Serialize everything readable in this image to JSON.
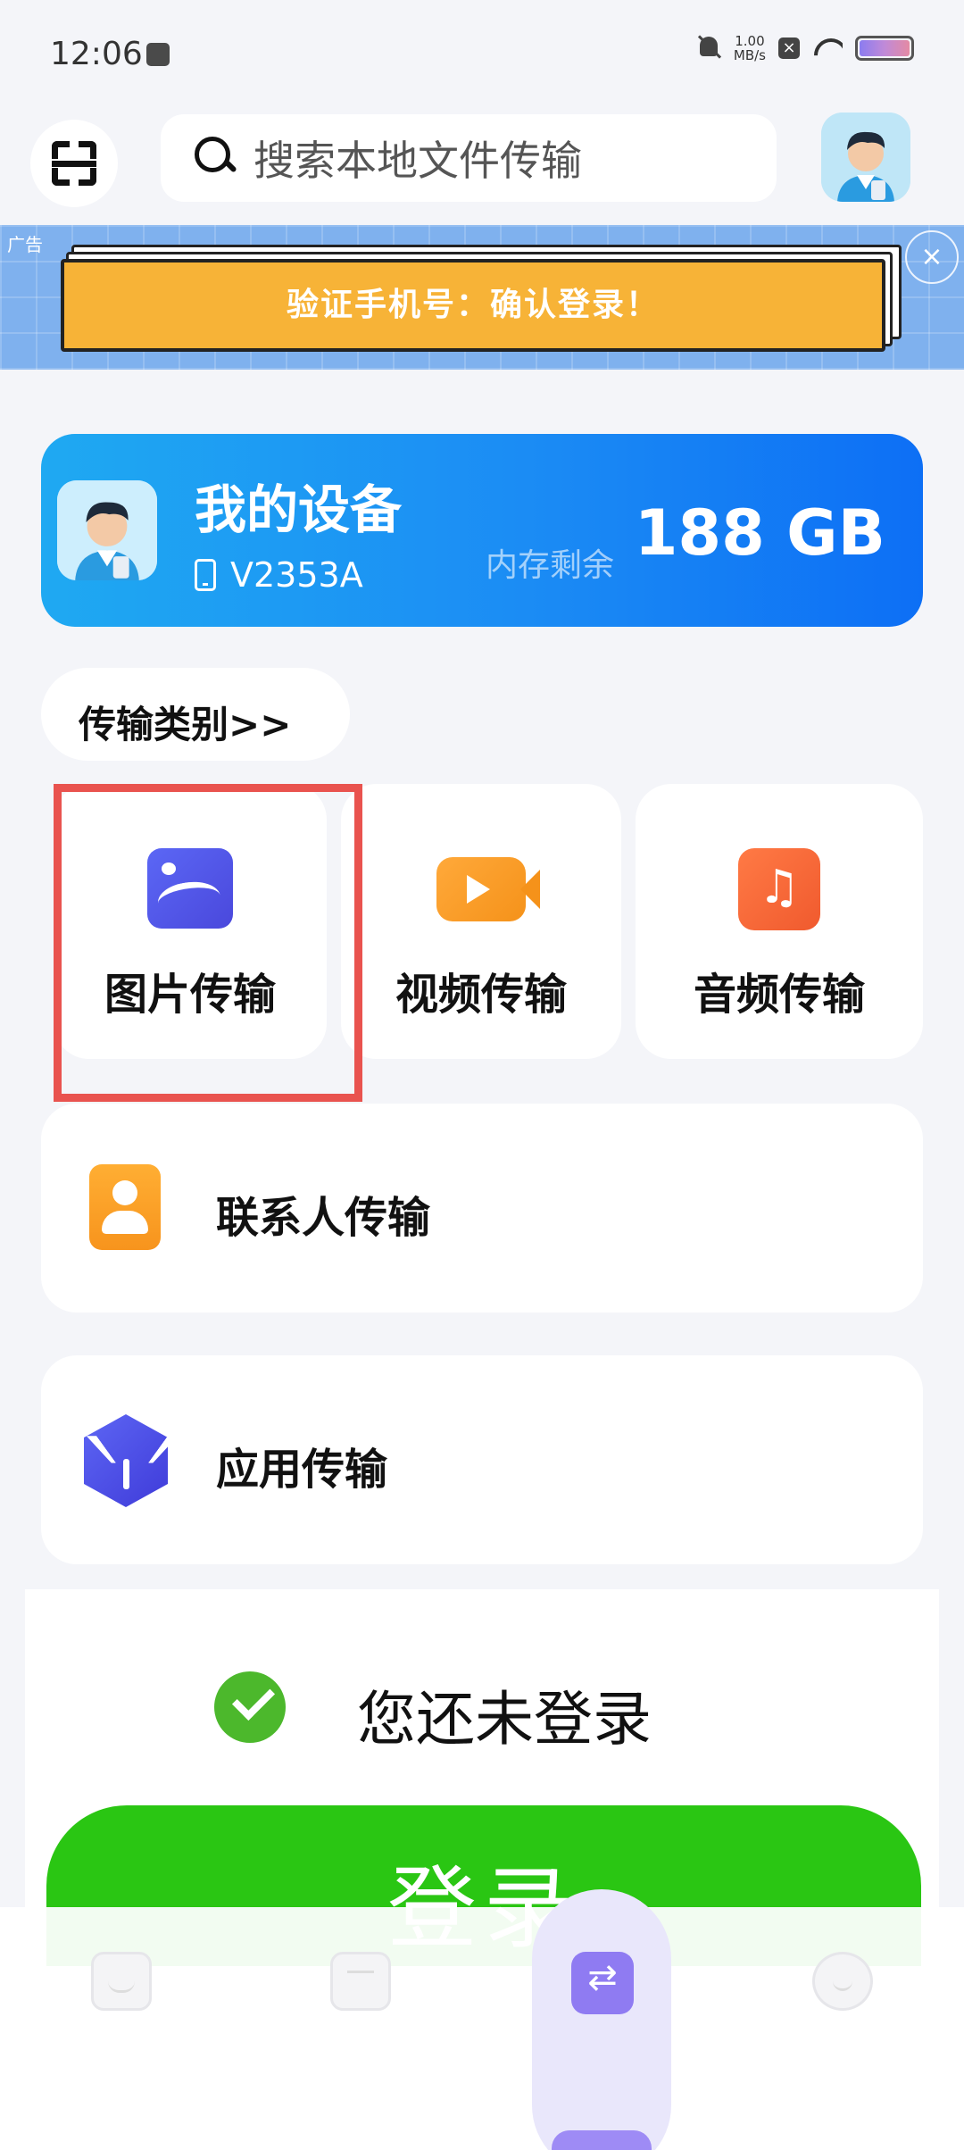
{
  "status_bar": {
    "time": "12:06",
    "net_speed_value": "1.00",
    "net_speed_unit": "MB/s"
  },
  "search": {
    "placeholder": "搜索本地文件传输"
  },
  "ad": {
    "tag": "广告",
    "text": "验证手机号：确认登录！"
  },
  "device": {
    "title": "我的设备",
    "model": "V2353A",
    "storage_label": "内存剩余",
    "storage_value": "188 GB"
  },
  "categories": {
    "header": "传输类别>>",
    "photo": "图片传输",
    "video": "视频传输",
    "audio": "音频传输",
    "contacts": "联系人传输",
    "apps": "应用传输"
  },
  "login": {
    "status": "您还未登录",
    "button": "登录"
  },
  "colors": {
    "device_card": "#1b8cf4",
    "highlight": "#e9534f",
    "login_button": "#2ac613",
    "nav_active": "#8f7bf2"
  },
  "icons": {
    "scan": "scan-icon",
    "search": "search-icon",
    "photo": "photo-icon",
    "video": "video-camera-icon",
    "audio": "music-note-icon",
    "contacts": "contact-person-icon",
    "apps": "app-cube-icon",
    "check": "check-icon",
    "nav": [
      "home-icon",
      "files-icon",
      "transfer-icon",
      "profile-icon"
    ]
  }
}
